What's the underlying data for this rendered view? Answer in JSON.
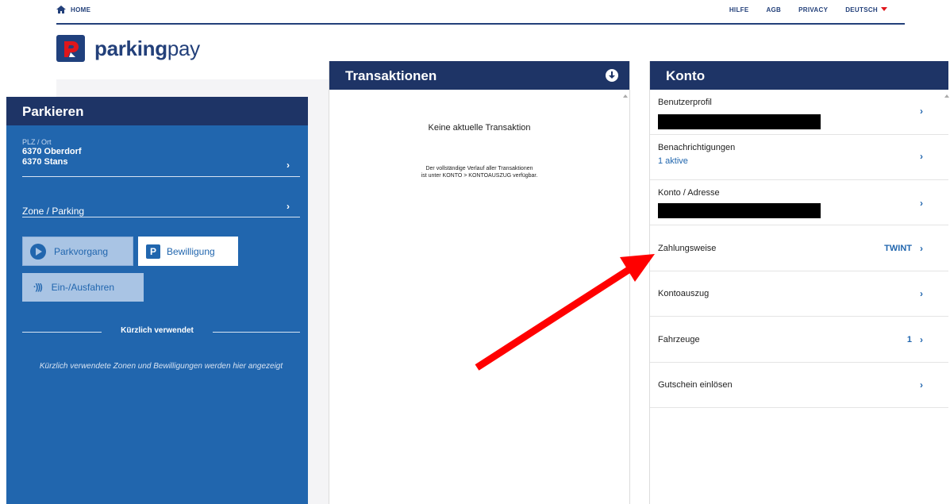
{
  "topnav": {
    "home": "HOME",
    "links": [
      "HILFE",
      "AGB",
      "PRIVACY"
    ],
    "language": "DEUTSCH"
  },
  "logo": {
    "bold": "parking",
    "light": "pay"
  },
  "parkieren": {
    "title": "Parkieren",
    "location_label": "PLZ / Ort",
    "locations": [
      "6370 Oberdorf",
      "6370 Stans"
    ],
    "zone_label": "Zone / Parking",
    "buttons": {
      "parkvorgang": "Parkvorgang",
      "bewilligung": "Bewilligung",
      "ein_ausfahren": "Ein-/Ausfahren"
    },
    "recent_title": "Kürzlich verwendet",
    "recent_text": "Kürzlich verwendete Zonen und Bewilligungen werden hier angezeigt"
  },
  "transaktionen": {
    "title": "Transaktionen",
    "empty": "Keine aktuelle Transaktion",
    "note_line1": "Der vollständige Verlauf aller Transaktionen",
    "note_line2": "ist unter KONTO > KONTOAUSZUG verfügbar."
  },
  "konto": {
    "title": "Konto",
    "rows": [
      {
        "title": "Benutzerprofil"
      },
      {
        "title": "Benachrichtigungen",
        "sub": "1 aktive"
      },
      {
        "title": "Konto / Adresse"
      },
      {
        "title": "Zahlungsweise",
        "value": "TWINT"
      },
      {
        "title": "Kontoauszug"
      },
      {
        "title": "Fahrzeuge",
        "value": "1"
      },
      {
        "title": "Gutschein einlösen"
      }
    ]
  },
  "colors": {
    "header_navy": "#1e3466",
    "panel_blue": "#2166ae",
    "annotation_arrow": "#ff0000"
  }
}
